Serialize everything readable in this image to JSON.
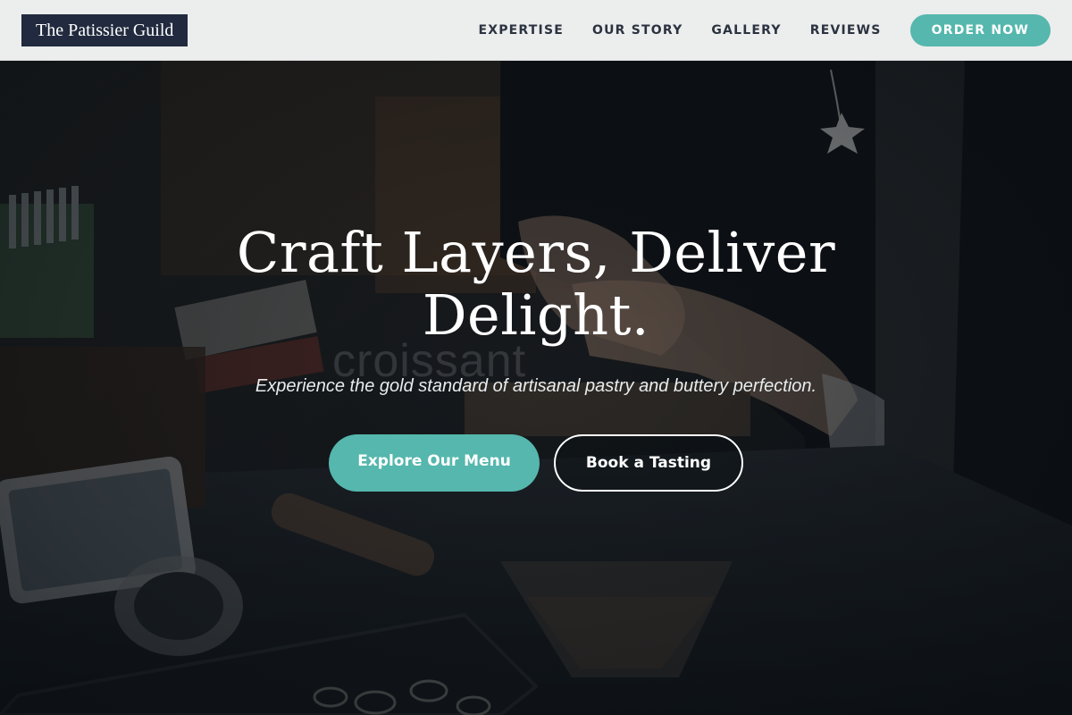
{
  "header": {
    "logo": "The Patissier Guild",
    "nav": {
      "expertise": "EXPERTISE",
      "our_story": "OUR STORY",
      "gallery": "GALLERY",
      "reviews": "REVIEWS"
    },
    "cta": "ORDER NOW"
  },
  "hero": {
    "watermark": "croissant",
    "title_line1": "Craft Layers, Deliver",
    "title_line2": "Delight.",
    "subtitle": "Experience the gold standard of artisanal pastry and buttery perfection.",
    "primary_button": "Explore Our Menu",
    "secondary_button": "Book a Tasting"
  },
  "colors": {
    "accent": "#55b7ad",
    "logo_bg": "#212a3e",
    "header_bg": "#eceded",
    "nav_text": "#2b3340"
  }
}
